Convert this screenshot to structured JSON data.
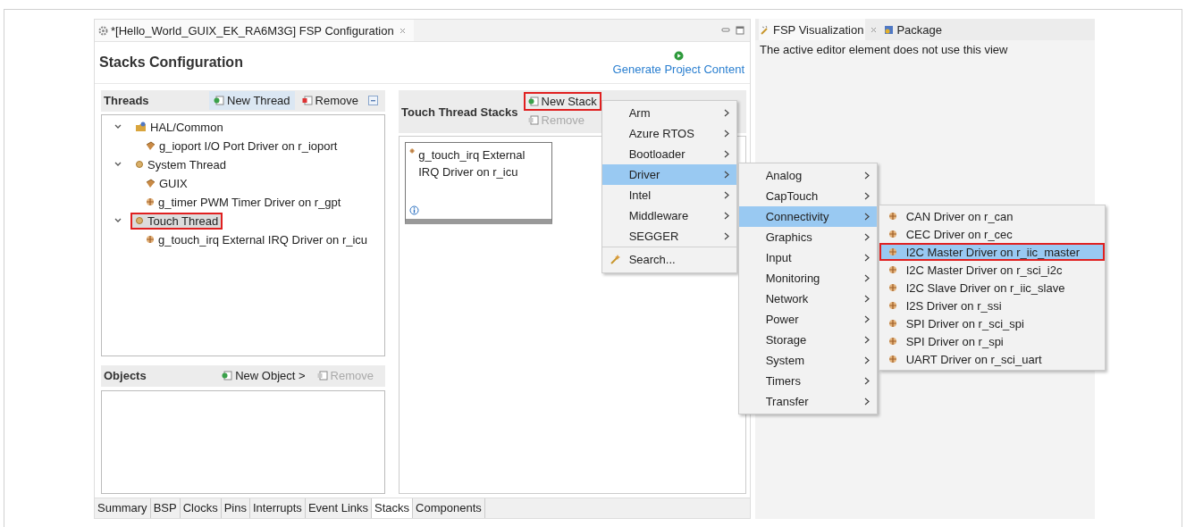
{
  "editor": {
    "tab_title": "*[Hello_World_GUIX_EK_RA6M3G] FSP Configuration",
    "page_title": "Stacks Configuration",
    "generate_link": "Generate Project Content"
  },
  "threads": {
    "title": "Threads",
    "buttons": [
      {
        "label": "New Thread",
        "kind": "new",
        "disabled": false,
        "hovered": true,
        "highlighted": false
      },
      {
        "label": "Remove",
        "kind": "remove",
        "disabled": false,
        "hovered": false,
        "highlighted": false
      }
    ],
    "tree": [
      {
        "label": "HAL/Common",
        "kind": "folder",
        "expanded": true,
        "selected": false,
        "highlighted": false,
        "children": [
          {
            "label": "g_ioport I/O Port Driver on r_ioport",
            "kind": "module",
            "selected": false,
            "highlighted": false
          }
        ]
      },
      {
        "label": "System Thread",
        "kind": "thread",
        "expanded": true,
        "selected": false,
        "highlighted": false,
        "children": [
          {
            "label": "GUIX",
            "kind": "module",
            "selected": false,
            "highlighted": false
          },
          {
            "label": "g_timer PWM Timer Driver on r_gpt",
            "kind": "driver",
            "selected": false,
            "highlighted": false
          }
        ]
      },
      {
        "label": "Touch Thread",
        "kind": "thread",
        "expanded": true,
        "selected": true,
        "highlighted": true,
        "children": [
          {
            "label": "g_touch_irq External IRQ Driver on r_icu",
            "kind": "driver",
            "selected": false,
            "highlighted": false
          }
        ]
      }
    ]
  },
  "objects": {
    "title": "Objects",
    "buttons": [
      {
        "label": "New Object >",
        "kind": "new",
        "disabled": false,
        "hovered": false,
        "highlighted": false
      },
      {
        "label": "Remove",
        "kind": "remove",
        "disabled": true,
        "hovered": false,
        "highlighted": false
      }
    ]
  },
  "stacks": {
    "title": "Touch Thread Stacks",
    "buttons": [
      {
        "label": "New Stack",
        "kind": "new",
        "disabled": false,
        "hovered": false,
        "highlighted": true
      },
      {
        "label": "Remove",
        "kind": "remove",
        "disabled": true,
        "hovered": false,
        "highlighted": false
      }
    ],
    "cards": [
      {
        "label": "g_touch_irq External IRQ Driver on r_icu"
      }
    ]
  },
  "bottom_tabs": [
    {
      "label": "Summary",
      "selected": false
    },
    {
      "label": "BSP",
      "selected": false
    },
    {
      "label": "Clocks",
      "selected": false
    },
    {
      "label": "Pins",
      "selected": false
    },
    {
      "label": "Interrupts",
      "selected": false
    },
    {
      "label": "Event Links",
      "selected": false
    },
    {
      "label": "Stacks",
      "selected": true
    },
    {
      "label": "Components",
      "selected": false
    }
  ],
  "side_view": {
    "tabs": [
      {
        "label": "FSP Visualization",
        "kind": "visualization",
        "selected": true
      },
      {
        "label": "Package",
        "kind": "package",
        "selected": false
      }
    ],
    "message": "The active editor element does not use this view"
  },
  "menus": [
    {
      "items": [
        {
          "label": "Arm",
          "kind": "submenu",
          "selected": false,
          "highlighted": false
        },
        {
          "label": "Azure RTOS",
          "kind": "submenu",
          "selected": false,
          "highlighted": false
        },
        {
          "label": "Bootloader",
          "kind": "submenu",
          "selected": false,
          "highlighted": false
        },
        {
          "label": "Driver",
          "kind": "submenu",
          "selected": true,
          "highlighted": false
        },
        {
          "label": "Intel",
          "kind": "submenu",
          "selected": false,
          "highlighted": false
        },
        {
          "label": "Middleware",
          "kind": "submenu",
          "selected": false,
          "highlighted": false
        },
        {
          "label": "SEGGER",
          "kind": "submenu",
          "selected": false,
          "highlighted": false
        },
        {
          "label": "Search...",
          "kind": "search",
          "selected": false,
          "highlighted": false
        }
      ]
    },
    {
      "items": [
        {
          "label": "Analog",
          "kind": "submenu",
          "selected": false,
          "highlighted": false
        },
        {
          "label": "CapTouch",
          "kind": "submenu",
          "selected": false,
          "highlighted": false
        },
        {
          "label": "Connectivity",
          "kind": "submenu",
          "selected": true,
          "highlighted": false
        },
        {
          "label": "Graphics",
          "kind": "submenu",
          "selected": false,
          "highlighted": false
        },
        {
          "label": "Input",
          "kind": "submenu",
          "selected": false,
          "highlighted": false
        },
        {
          "label": "Monitoring",
          "kind": "submenu",
          "selected": false,
          "highlighted": false
        },
        {
          "label": "Network",
          "kind": "submenu",
          "selected": false,
          "highlighted": false
        },
        {
          "label": "Power",
          "kind": "submenu",
          "selected": false,
          "highlighted": false
        },
        {
          "label": "Storage",
          "kind": "submenu",
          "selected": false,
          "highlighted": false
        },
        {
          "label": "System",
          "kind": "submenu",
          "selected": false,
          "highlighted": false
        },
        {
          "label": "Timers",
          "kind": "submenu",
          "selected": false,
          "highlighted": false
        },
        {
          "label": "Transfer",
          "kind": "submenu",
          "selected": false,
          "highlighted": false
        }
      ]
    },
    {
      "items": [
        {
          "label": "CAN Driver on r_can",
          "kind": "driver",
          "selected": false,
          "highlighted": false
        },
        {
          "label": "CEC Driver on r_cec",
          "kind": "driver",
          "selected": false,
          "highlighted": false
        },
        {
          "label": "I2C Master Driver on r_iic_master",
          "kind": "driver",
          "selected": true,
          "highlighted": true
        },
        {
          "label": "I2C Master Driver on r_sci_i2c",
          "kind": "driver",
          "selected": false,
          "highlighted": false
        },
        {
          "label": "I2C Slave Driver on r_iic_slave",
          "kind": "driver",
          "selected": false,
          "highlighted": false
        },
        {
          "label": "I2S Driver on r_ssi",
          "kind": "driver",
          "selected": false,
          "highlighted": false
        },
        {
          "label": "SPI Driver on r_sci_spi",
          "kind": "driver",
          "selected": false,
          "highlighted": false
        },
        {
          "label": "SPI Driver on r_spi",
          "kind": "driver",
          "selected": false,
          "highlighted": false
        },
        {
          "label": "UART Driver on r_sci_uart",
          "kind": "driver",
          "selected": false,
          "highlighted": false
        }
      ]
    }
  ]
}
